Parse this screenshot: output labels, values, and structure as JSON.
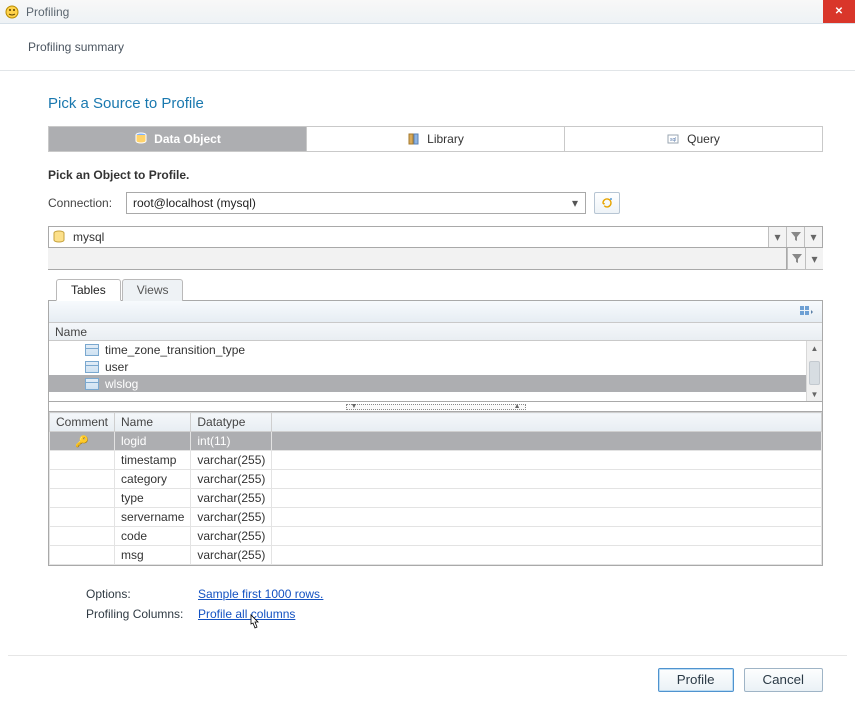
{
  "window": {
    "title": "Profiling"
  },
  "summary": "Profiling summary",
  "section_title": "Pick a Source to Profile",
  "source_tabs": {
    "data_object": "Data Object",
    "library": "Library",
    "query": "Query"
  },
  "subheading": "Pick an Object to Profile.",
  "connection": {
    "label": "Connection:",
    "value": "root@localhost (mysql)"
  },
  "database": {
    "value": "mysql"
  },
  "tv_tabs": {
    "tables": "Tables",
    "views": "Views"
  },
  "name_header": "Name",
  "tree_items": [
    {
      "label": "time_zone_transition_type",
      "selected": false
    },
    {
      "label": "user",
      "selected": false
    },
    {
      "label": "wlslog",
      "selected": true
    }
  ],
  "grid": {
    "headers": {
      "comment": "Comment",
      "name": "Name",
      "datatype": "Datatype"
    },
    "rows": [
      {
        "name": "logid",
        "datatype": "int(11)",
        "selected": true,
        "key": true
      },
      {
        "name": "timestamp",
        "datatype": "varchar(255)",
        "selected": false,
        "key": false
      },
      {
        "name": "category",
        "datatype": "varchar(255)",
        "selected": false,
        "key": false
      },
      {
        "name": "type",
        "datatype": "varchar(255)",
        "selected": false,
        "key": false
      },
      {
        "name": "servername",
        "datatype": "varchar(255)",
        "selected": false,
        "key": false
      },
      {
        "name": "code",
        "datatype": "varchar(255)",
        "selected": false,
        "key": false
      },
      {
        "name": "msg",
        "datatype": "varchar(255)",
        "selected": false,
        "key": false
      }
    ]
  },
  "options": {
    "options_label": "Options:",
    "sample_link": "Sample first 1000 rows.",
    "profiling_columns_label": "Profiling Columns:",
    "profile_all_link": "Profile all columns"
  },
  "buttons": {
    "profile": "Profile",
    "cancel": "Cancel"
  }
}
